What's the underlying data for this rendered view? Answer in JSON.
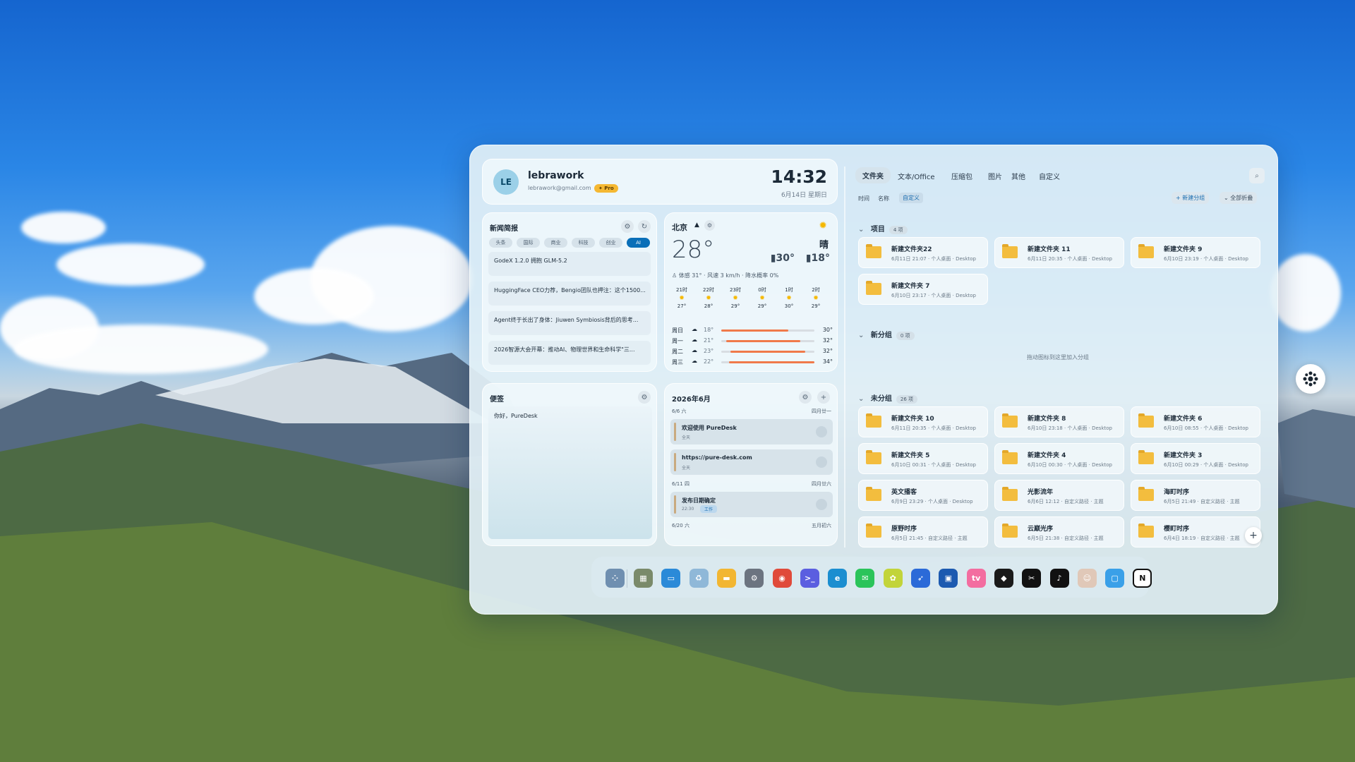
{
  "user": {
    "initials": "LE",
    "name": "lebrawork",
    "email": "lebrawork@gmail.com",
    "badge": "✦ Pro"
  },
  "clock": {
    "time": "14:32",
    "date": "6月14日 星期日"
  },
  "news": {
    "title": "新闻简报",
    "categories": [
      "头条",
      "国际",
      "商业",
      "科技",
      "创业",
      "AI"
    ],
    "active_category": "AI",
    "items": [
      "GodeX 1.2.0 拥抱 GLM-5.2",
      "HuggingFace CEO力荐，Bengio团队也押注：这个1500...",
      "Agent终于长出了身体：Jiuwen Symbiosis背后的思考...",
      "2026智源大会开幕：推动AI、物理世界和生命科学\"三..."
    ]
  },
  "weather": {
    "city": "北京",
    "temp": "28°",
    "condition": "晴",
    "high": "30°",
    "low": "18°",
    "detail": "体感 31° · 风速 3 km/h · 降水概率 0%",
    "hourly": [
      {
        "time": "21时",
        "temp": "27°"
      },
      {
        "time": "22时",
        "temp": "28°"
      },
      {
        "time": "23时",
        "temp": "29°"
      },
      {
        "time": "0时",
        "temp": "29°"
      },
      {
        "time": "1时",
        "temp": "30°"
      },
      {
        "time": "2时",
        "temp": "29°"
      }
    ],
    "daily": [
      {
        "day": "周日",
        "low": "18°",
        "high": "30°",
        "fill_start": 0.0,
        "fill_end": 0.72
      },
      {
        "day": "周一",
        "low": "21°",
        "high": "32°",
        "fill_start": 0.05,
        "fill_end": 0.85
      },
      {
        "day": "周二",
        "low": "23°",
        "high": "32°",
        "fill_start": 0.1,
        "fill_end": 0.9
      },
      {
        "day": "周三",
        "low": "22°",
        "high": "34°",
        "fill_start": 0.08,
        "fill_end": 1.0
      }
    ]
  },
  "notes": {
    "title": "便签",
    "content": "你好，PureDesk"
  },
  "calendar": {
    "title": "2026年6月",
    "groups": [
      {
        "date": "6/6 六",
        "lunar": "四月廿一"
      },
      {
        "date": "6/11 四",
        "lunar": "四月廿六"
      },
      {
        "date": "6/20 六",
        "lunar": "五月初六"
      }
    ],
    "events": [
      {
        "title": "欢迎使用 PureDesk",
        "sub": "全天",
        "tag": ""
      },
      {
        "title": "https://pure-desk.com",
        "sub": "全天",
        "tag": ""
      },
      {
        "title": "发布日期确定",
        "sub": "22:30",
        "tag": "工作"
      }
    ]
  },
  "files": {
    "tabs": [
      "文件夹",
      "文本/Office",
      "压缩包",
      "图片",
      "其他",
      "自定义"
    ],
    "active_tab": "文件夹",
    "sort": [
      "时间",
      "名称",
      "自定义"
    ],
    "active_sort": "自定义",
    "new_group": "+ 新建分组",
    "collapse_all": "⌄ 全部折叠",
    "groups": [
      {
        "name": "项目",
        "count": "4 项",
        "items": [
          {
            "name": "新建文件夹22",
            "meta": "6月11日 21:07 · 个人桌面 · Desktop"
          },
          {
            "name": "新建文件夹 11",
            "meta": "6月11日 20:35 · 个人桌面 · Desktop"
          },
          {
            "name": "新建文件夹 9",
            "meta": "6月10日 23:19 · 个人桌面 · Desktop"
          },
          {
            "name": "新建文件夹 7",
            "meta": "6月10日 23:17 · 个人桌面 · Desktop"
          }
        ]
      },
      {
        "name": "新分组",
        "count": "0 项",
        "empty_hint": "拖动图标到这里加入分组",
        "items": []
      },
      {
        "name": "未分组",
        "count": "26 项",
        "items": [
          {
            "name": "新建文件夹 10",
            "meta": "6月11日 20:35 · 个人桌面 · Desktop"
          },
          {
            "name": "新建文件夹 8",
            "meta": "6月10日 23:18 · 个人桌面 · Desktop"
          },
          {
            "name": "新建文件夹 6",
            "meta": "6月10日 08:55 · 个人桌面 · Desktop"
          },
          {
            "name": "新建文件夹 5",
            "meta": "6月10日 00:31 · 个人桌面 · Desktop"
          },
          {
            "name": "新建文件夹 4",
            "meta": "6月10日 00:30 · 个人桌面 · Desktop"
          },
          {
            "name": "新建文件夹 3",
            "meta": "6月10日 00:29 · 个人桌面 · Desktop"
          },
          {
            "name": "英文播客",
            "meta": "6月9日 23:29 · 个人桌面 · Desktop"
          },
          {
            "name": "光影流年",
            "meta": "6月6日 12:12 · 自定义路径 · 主题"
          },
          {
            "name": "海町时序",
            "meta": "6月5日 21:49 · 自定义路径 · 主题"
          },
          {
            "name": "原野时序",
            "meta": "6月5日 21:45 · 自定义路径 · 主题"
          },
          {
            "name": "云巅光序",
            "meta": "6月5日 21:38 · 自定义路径 · 主题"
          },
          {
            "name": "樱町时序",
            "meta": "6月4日 18:19 · 自定义路径 · 主题"
          }
        ]
      }
    ]
  },
  "dock": [
    {
      "icon": "launcher-icon",
      "color": "#6f8fb0"
    },
    {
      "icon": "widgets-icon",
      "color": "#7a8a6a"
    },
    {
      "icon": "desktop-icon",
      "color": "#2b8ad8"
    },
    {
      "icon": "recycle-bin-icon",
      "color": "#8fb8d8"
    },
    {
      "icon": "file-explorer-icon",
      "color": "#f2b632"
    },
    {
      "icon": "settings-icon",
      "color": "#6c7480"
    },
    {
      "icon": "chrome-icon",
      "color": "#e04a3a"
    },
    {
      "icon": "terminal-app-icon",
      "color": "#5b5ee0"
    },
    {
      "icon": "edge-icon",
      "color": "#1b8ed0"
    },
    {
      "icon": "wechat-icon",
      "color": "#2bc45a"
    },
    {
      "icon": "app-swirl-icon",
      "color": "#c2d43a"
    },
    {
      "icon": "bird-app-icon",
      "color": "#2b6ad8"
    },
    {
      "icon": "store-icon",
      "color": "#1c5ab0"
    },
    {
      "icon": "bilibili-icon",
      "color": "#f36da0"
    },
    {
      "icon": "cube-app-icon",
      "color": "#1a1a1a"
    },
    {
      "icon": "capcut-icon",
      "color": "#111111"
    },
    {
      "icon": "tiktok-icon",
      "color": "#111111"
    },
    {
      "icon": "avatar-app-icon",
      "color": "#e0c8b8"
    },
    {
      "icon": "chat-bubble-icon",
      "color": "#3aa0e8"
    },
    {
      "icon": "notion-icon",
      "color": "#ffffff"
    }
  ]
}
